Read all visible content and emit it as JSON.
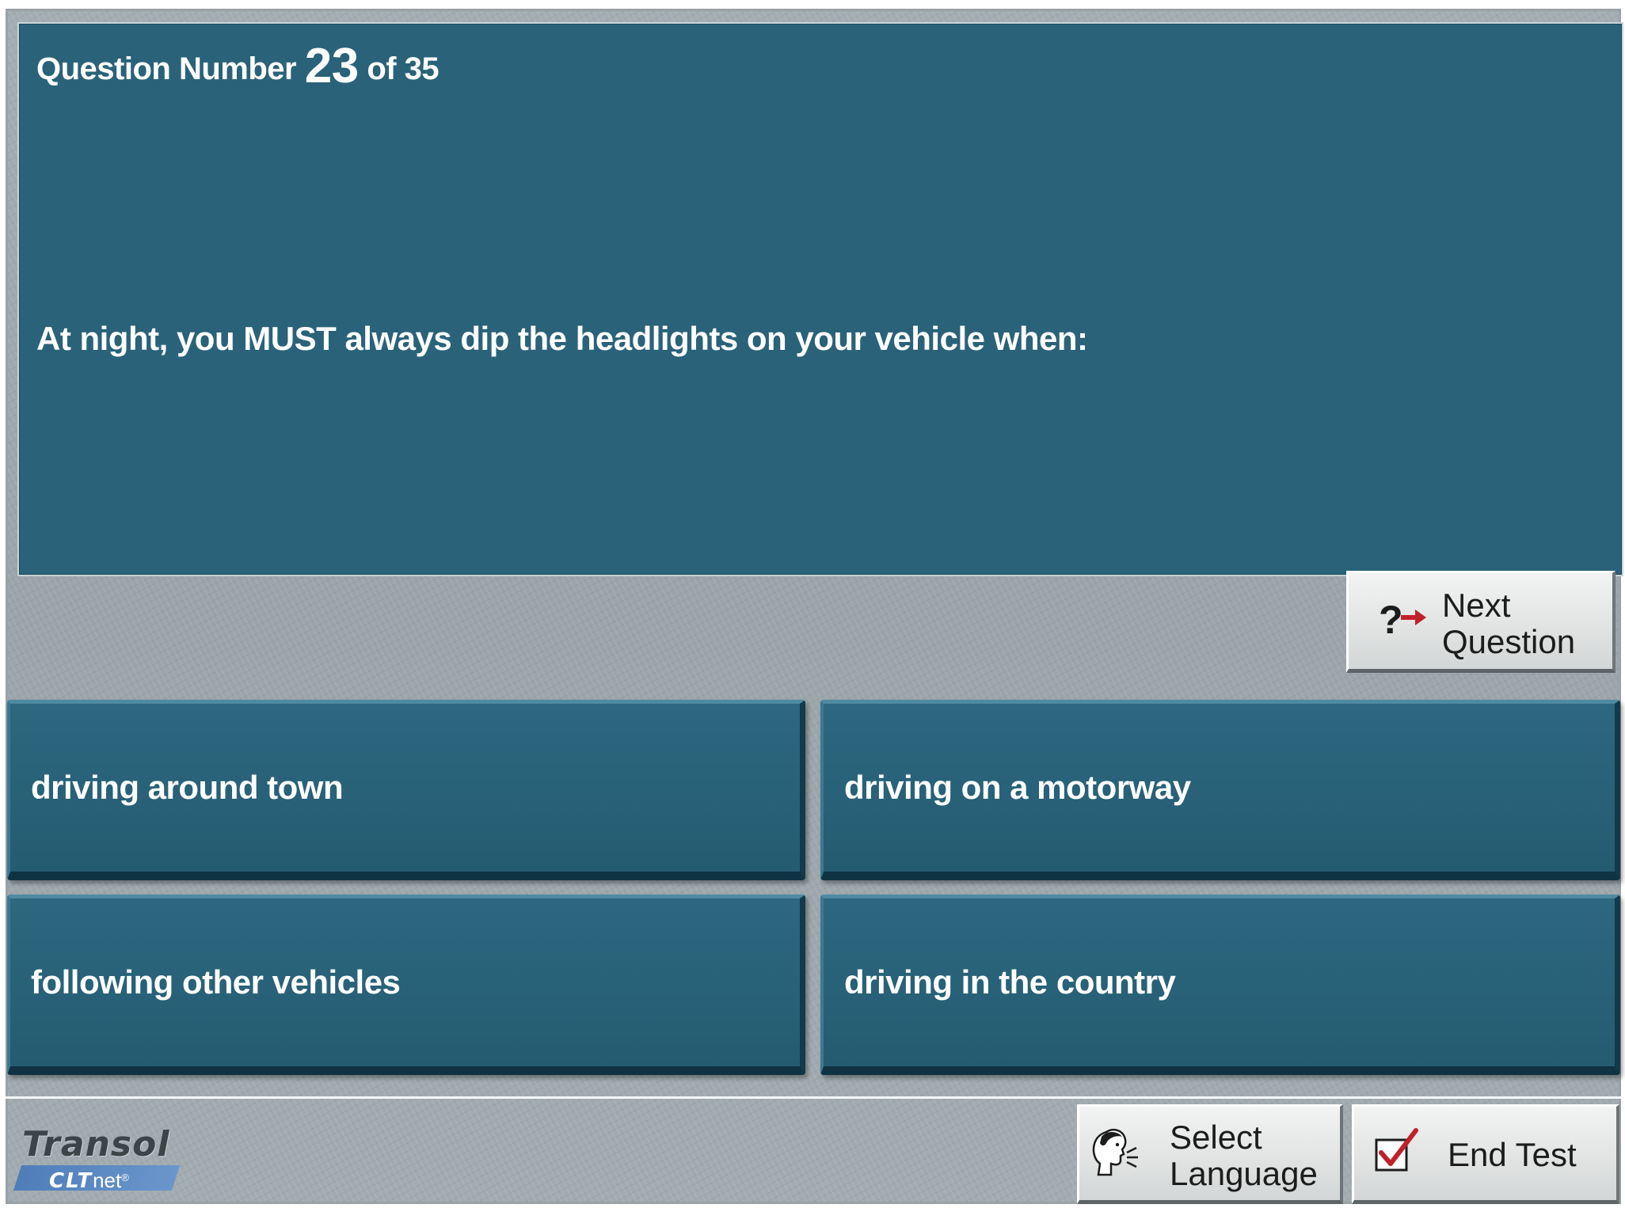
{
  "question": {
    "number_prefix": "Question Number",
    "number": "23",
    "number_suffix": "of 35",
    "text": "At night, you MUST always dip the headlights on your vehicle when:"
  },
  "answers": [
    {
      "text": "driving around town"
    },
    {
      "text": "driving on a motorway"
    },
    {
      "text": "following other vehicles"
    },
    {
      "text": "driving in the country"
    }
  ],
  "next_button": {
    "line1": "Next",
    "line2": "Question",
    "icon": "question-arrow-icon"
  },
  "language_button": {
    "line1": "Select",
    "line2": "Language",
    "icon": "speaking-head-icon"
  },
  "end_button": {
    "label": "End Test",
    "icon": "checkbox-tick-icon"
  },
  "logo": {
    "brand": "Transol",
    "product_bold": "CLT",
    "product_light": "net",
    "reg_mark": "®"
  },
  "colors": {
    "panel": "#2a6279",
    "answer": "#29637a",
    "background": "#9ea8ad",
    "arrow_red": "#c0202a"
  }
}
